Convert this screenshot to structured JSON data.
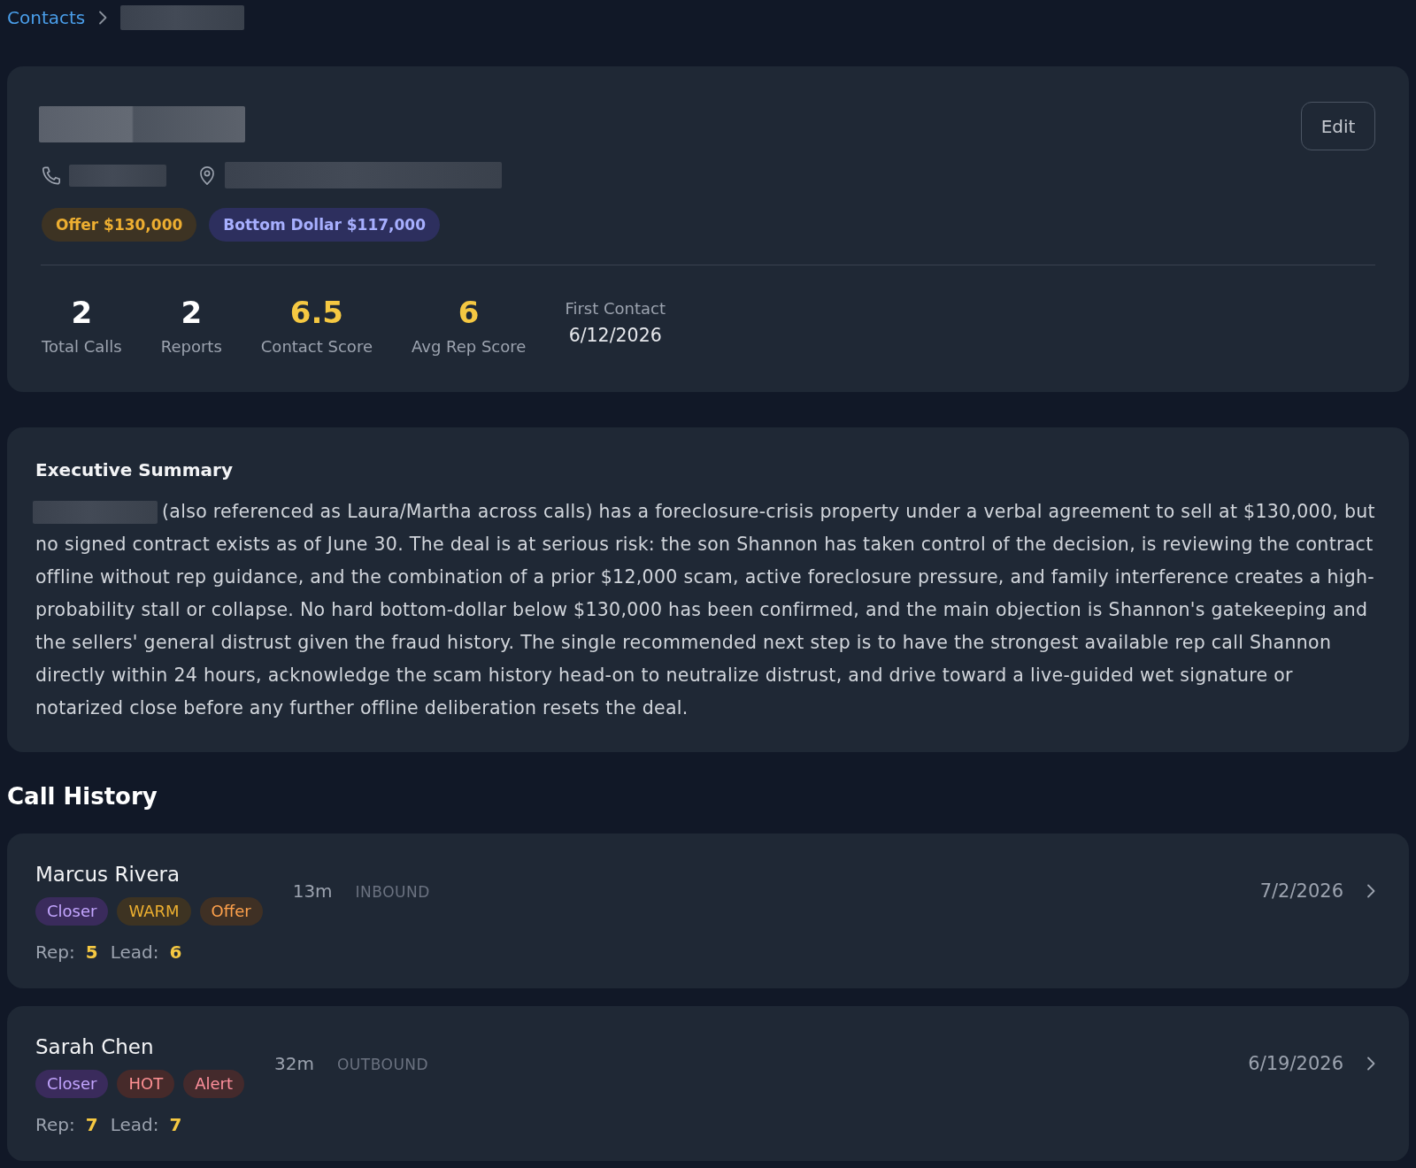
{
  "breadcrumb": [
    {
      "kind": "link",
      "label": "Contacts"
    },
    {
      "kind": "redacted"
    }
  ],
  "contact": {
    "name_redacted": true,
    "details": [
      {
        "kind": "phone",
        "redacted": true
      },
      {
        "kind": "location",
        "redacted": true
      }
    ],
    "badges": [
      {
        "label": "Offer $130,000",
        "color": "#3d3323"
      },
      {
        "label": "Bottom Dollar $117,000",
        "color": "#2d2f5e"
      }
    ],
    "edit_button": "Edit"
  },
  "stats": [
    {
      "kind": "metric",
      "value": "2",
      "label": "Total Calls",
      "highlight": false
    },
    {
      "kind": "metric",
      "value": "2",
      "label": "Reports",
      "highlight": false
    },
    {
      "kind": "metric",
      "value": "6.5",
      "label": "Contact Score",
      "highlight": true
    },
    {
      "kind": "metric",
      "value": "6",
      "label": "Avg Rep Score",
      "highlight": true
    },
    {
      "kind": "date",
      "label": "First Contact",
      "value": "6/12/2026"
    }
  ],
  "summary": {
    "title": "Executive Summary",
    "subject_redacted": true,
    "text": "(also referenced as Laura/Martha across calls) has a foreclosure-crisis property under a verbal agreement to sell at $130,000, but no signed contract exists as of June 30. The deal is at serious risk: the son Shannon has taken control of the decision, is reviewing the contract offline without rep guidance, and the combination of a prior $12,000 scam, active foreclosure pressure, and family interference creates a high-probability stall or collapse. No hard bottom-dollar below $130,000 has been confirmed, and the main objection is Shannon's gatekeeping and the sellers' general distrust given the fraud history. The single recommended next step is to have the strongest available rep call Shannon directly within 24 hours, acknowledge the scam history head-on to neutralize distrust, and drive toward a live-guided wet signature or notarized close before any further offline deliberation resets the deal."
  },
  "call_history": {
    "title": "Call History",
    "calls": [
      {
        "rep": "Marcus Rivera",
        "tags": [
          {
            "label": "Closer",
            "color": "#3a2b5c"
          },
          {
            "label": "WARM",
            "color": "#3d3322"
          },
          {
            "label": "Offer",
            "color": "#3f3024"
          }
        ],
        "scores": [
          {
            "label": "Rep:",
            "value": "5"
          },
          {
            "label": "Lead:",
            "value": "6"
          }
        ],
        "duration": "13m",
        "direction": "INBOUND",
        "date": "7/2/2026"
      },
      {
        "rep": "Sarah Chen",
        "tags": [
          {
            "label": "Closer",
            "color": "#3a2b5c"
          },
          {
            "label": "HOT",
            "color": "#462a2a"
          },
          {
            "label": "Alert",
            "color": "#442a2c"
          }
        ],
        "scores": [
          {
            "label": "Rep:",
            "value": "7"
          },
          {
            "label": "Lead:",
            "value": "7"
          }
        ],
        "duration": "32m",
        "direction": "OUTBOUND",
        "date": "6/19/2026"
      }
    ]
  }
}
